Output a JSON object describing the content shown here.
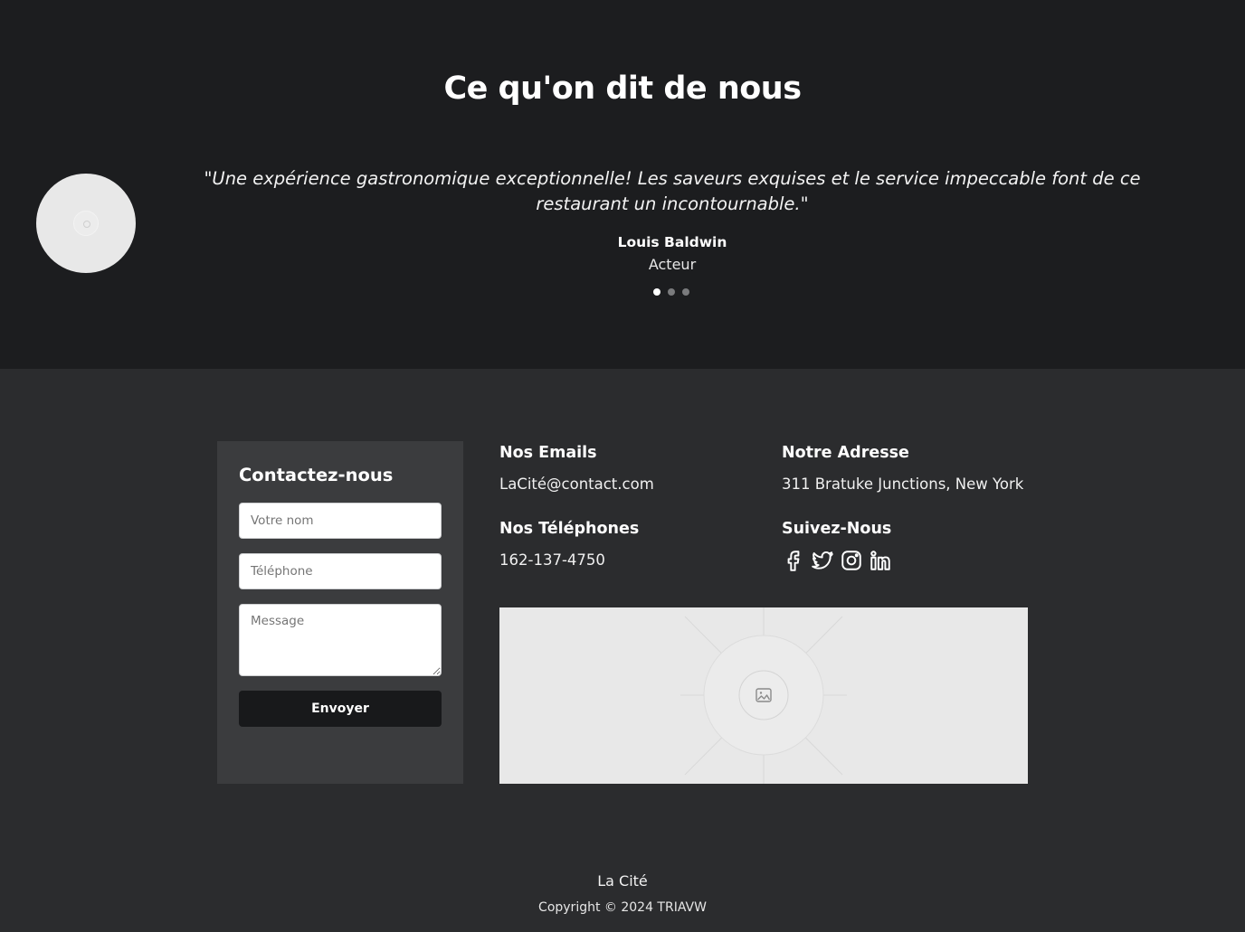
{
  "testimonials": {
    "title": "Ce qu'on dit de nous",
    "quote": "\"Une expérience gastronomique exceptionnelle! Les saveurs exquises et le service impeccable font de ce restaurant un incontournable.\"",
    "author": "Louis Baldwin",
    "role": "Acteur",
    "dots_total": 3,
    "active_dot": 1
  },
  "contact": {
    "title": "Contactez-nous",
    "name_placeholder": "Votre nom",
    "phone_placeholder": "Téléphone",
    "message_placeholder": "Message",
    "submit_label": "Envoyer"
  },
  "info": {
    "emails_heading": "Nos Emails",
    "email": "LaCité@contact.com",
    "address_heading": "Notre Adresse",
    "address": "311 Bratuke Junctions, New York",
    "phones_heading": "Nos Téléphones",
    "phone": "162-137-4750",
    "follow_heading": "Suivez-Nous",
    "social_icons": [
      "facebook-icon",
      "twitter-icon",
      "instagram-icon",
      "linkedin-icon"
    ]
  },
  "footer": {
    "brand": "La Cité",
    "copyright": "Copyright © 2024 TRIAVW"
  },
  "colors": {
    "testimonial_bg": "#1c1d1f",
    "page_bg": "#2b2c2e",
    "card_bg": "#3b3c3e",
    "button_bg": "#18191b",
    "placeholder_bg": "#e8e8e8"
  }
}
